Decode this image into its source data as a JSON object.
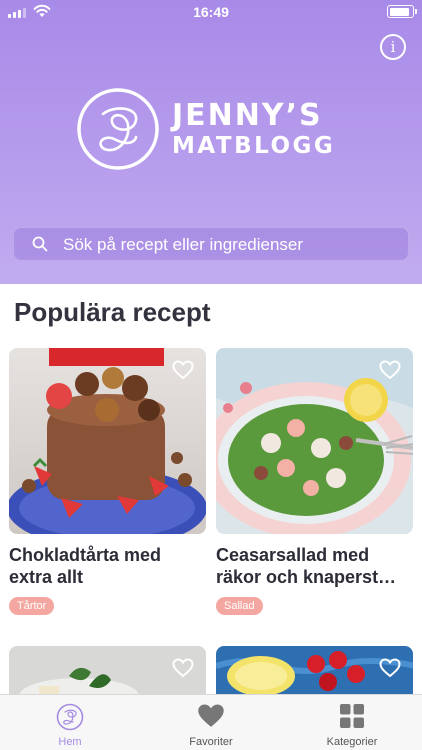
{
  "status_bar": {
    "time": "16:49"
  },
  "header": {
    "logo_line1": "JENNY’S",
    "logo_line2": "MATBLOGG",
    "background_color": "#b39aeb"
  },
  "search": {
    "placeholder": "Sök på recept eller ingredienser"
  },
  "popular": {
    "title": "Populära recept",
    "recipes": [
      {
        "title": "Chokladtårta med extra allt",
        "tag": "Tårtor"
      },
      {
        "title": "Ceasarsallad med räkor och knaperst…",
        "tag": "Sallad"
      }
    ]
  },
  "tabbar": {
    "items": [
      {
        "label": "Hem",
        "icon": "home-logo-icon",
        "active": true
      },
      {
        "label": "Favoriter",
        "icon": "heart-icon"
      },
      {
        "label": "Kategorier",
        "icon": "grid-icon"
      }
    ]
  },
  "colors": {
    "accent": "#a58ce2",
    "tag": "#f4a7a0"
  }
}
